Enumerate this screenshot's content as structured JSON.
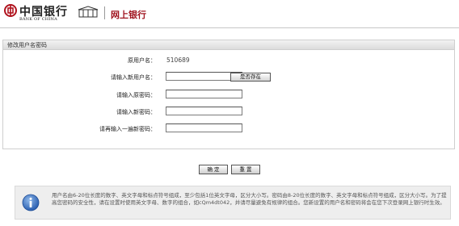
{
  "header": {
    "logo_cn": "中国银行",
    "logo_en": "BANK OF CHINA",
    "building_text": "",
    "title": "网上银行"
  },
  "form": {
    "section_title": "修改用户名密码",
    "rows": [
      {
        "label": "原用户名：",
        "value": "510689"
      },
      {
        "label": "请输入新用户名：",
        "value": ""
      },
      {
        "label": "请输入原密码：",
        "value": ""
      },
      {
        "label": "请输入新密码：",
        "value": ""
      },
      {
        "label": "请再输入一遍新密码：",
        "value": ""
      }
    ],
    "check_button": "是否存在"
  },
  "buttons": {
    "confirm": "确 定",
    "reset": "重 置"
  },
  "notice": {
    "text": "用户名由6-20位长度的数字、英文字母和标点符号组成，至少包括1位英文字母，区分大小写。密码由8-20位长度的数字、英文字母和标点符号组成，区分大小写。为了提高您密码的安全性，请在设置时使用英文字母、数字的组合，如cQm4dt042，并请尽量避免有规律的组合。您新设置的用户名和密码将会在您下次登录网上银行时生效。"
  },
  "colors": {
    "title": "#a0141f",
    "logo": "#b0121d"
  }
}
